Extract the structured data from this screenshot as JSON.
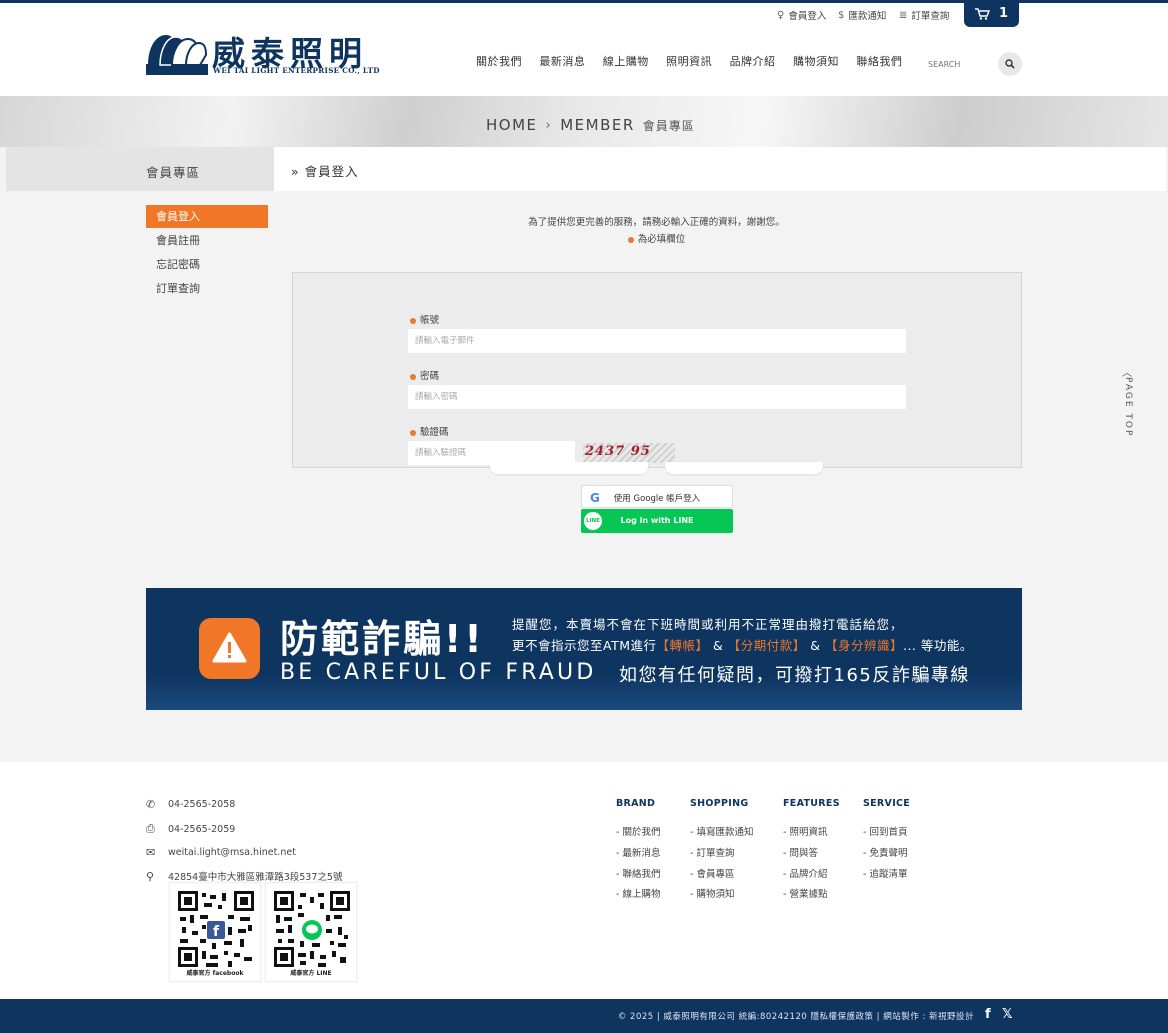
{
  "brand": {
    "name_cn": "威泰照明",
    "name_en": "WEI TAI LIGHT ENTERPRISE CO., LTD"
  },
  "util_links": [
    {
      "icon": "bulb-icon",
      "label": "會員登入"
    },
    {
      "icon": "dollar-icon",
      "label": "匯款通知"
    },
    {
      "icon": "list-icon",
      "label": "訂單查詢"
    }
  ],
  "cart": {
    "icon": "cart-icon",
    "count": "1"
  },
  "nav": [
    "關於我們",
    "最新消息",
    "線上購物",
    "照明資訊",
    "品牌介紹",
    "購物須知",
    "聯絡我們"
  ],
  "search": {
    "placeholder": "SEARCH",
    "icon": "search-icon"
  },
  "breadcrumb": {
    "home": "HOME",
    "sep": "›",
    "member": "MEMBER",
    "member_cn": "會員專區"
  },
  "sidebar": {
    "title": "會員專區",
    "items": [
      {
        "label": "會員登入",
        "active": true
      },
      {
        "label": "會員註冊",
        "active": false
      },
      {
        "label": "忘記密碼",
        "active": false
      },
      {
        "label": "訂單查詢",
        "active": false
      }
    ]
  },
  "page": {
    "title": "» 會員登入",
    "notice": "為了提供您更完善的服務，請務必輸入正確的資料，謝謝您。",
    "required_note": "為必填欄位"
  },
  "form": {
    "account_label": "帳號",
    "account_placeholder": "請輸入電子郵件",
    "password_label": "密碼",
    "password_placeholder": "請輸入密碼",
    "captcha_label": "驗證碼",
    "captcha_placeholder": "請輸入驗證碼",
    "captcha_text": "2437 95"
  },
  "social_login": {
    "google": "使用 Google 帳戶登入",
    "line": "Log in with LINE",
    "line_badge": "LINE"
  },
  "page_top": "PAGE TOP",
  "fraud": {
    "title": "防範詐騙!!",
    "en": "BE CAREFUL OF FRAUD",
    "line1": "提醒您，本賣場不會在下班時間或利用不正常理由撥打電話給您，",
    "line2_a": "更不會指示您至ATM進行",
    "hl1": "【轉帳】",
    "amp1": " & ",
    "hl2": "【分期付款】",
    "amp2": " & ",
    "hl3": "【身分辨識】",
    "line2_b": "... 等功能。",
    "line3": "如您有任何疑問，可撥打165反詐騙專線",
    "accent": "#f07628"
  },
  "contact": {
    "phone": "04-2565-2058",
    "fax": "04-2565-2059",
    "email": "weitai.light@msa.hinet.net",
    "address": "42854臺中市大雅區雅潭路3段537之5號"
  },
  "qr_codes": [
    {
      "caption": "威泰官方 facebook",
      "badge": "facebook-icon"
    },
    {
      "caption": "威泰官方 LINE",
      "badge": "line-icon"
    }
  ],
  "footer_cols": [
    {
      "title": "BRAND",
      "items": [
        "- 關於我們",
        "- 最新消息",
        "- 聯絡我們",
        "- 線上購物"
      ]
    },
    {
      "title": "SHOPPING",
      "items": [
        "- 填寫匯款通知",
        "- 訂單查詢",
        "- 會員專區",
        "- 購物須知"
      ]
    },
    {
      "title": "FEATURES",
      "items": [
        "- 照明資訊",
        "- 問與答",
        "- 品牌介紹",
        "- 營業據點"
      ]
    },
    {
      "title": "SERVICE",
      "items": [
        "- 回到首頁",
        "- 免責聲明",
        "- 追蹤清單"
      ]
    }
  ],
  "copyright": "© 2025 | 威泰照明有限公司   統編:80242120     隱私權保護政策   |     網站製作 : 新視野設計",
  "social": {
    "facebook": "f",
    "x": "𝕏"
  },
  "colors": {
    "navy": "#0e3460",
    "orange": "#f07628",
    "line_green": "#06c755"
  }
}
